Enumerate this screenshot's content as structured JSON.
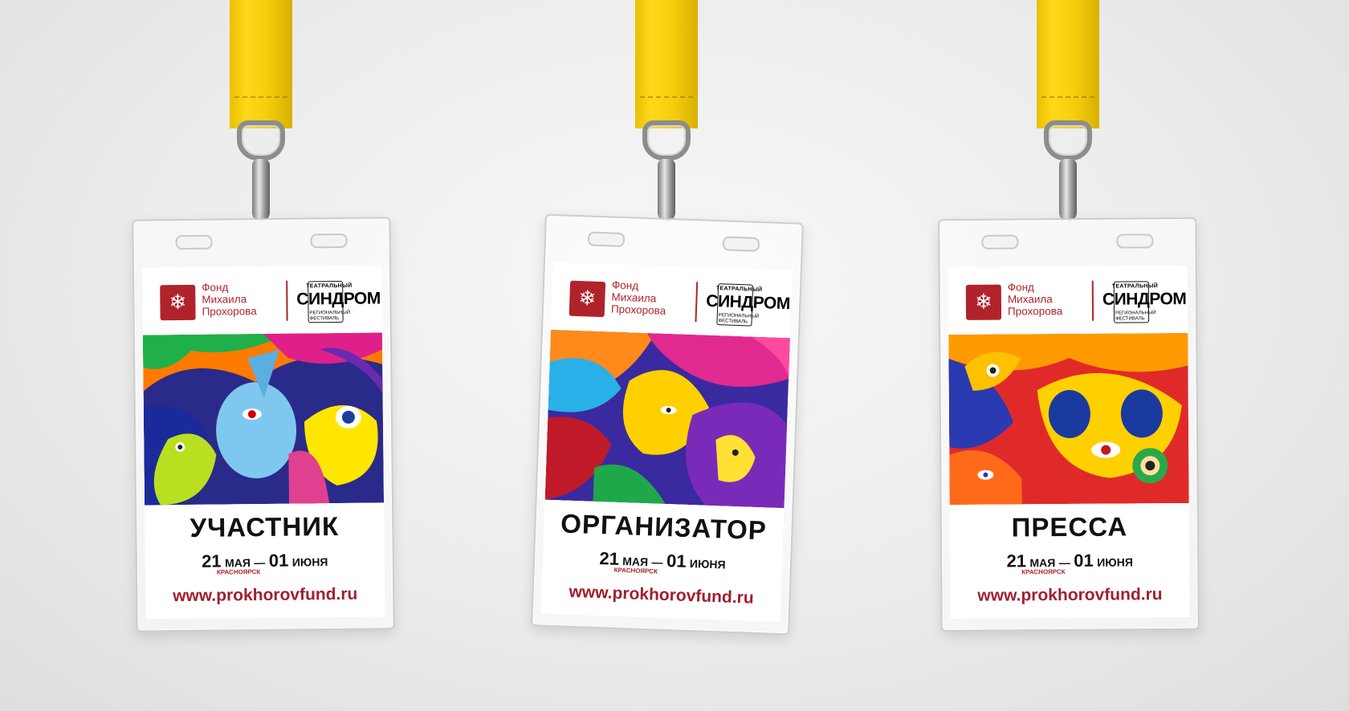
{
  "badges": [
    {
      "fund_name": "Фонд\nМихаила\nПрохорова",
      "fest_top": "ТЕАТРАЛЬНЫЙ",
      "fest_main": "СИНДРОМ",
      "fest_sub": "РЕГИОНАЛЬНЫЙ ФЕСТИВАЛЬ",
      "role": "УЧАСТНИК",
      "date_start_day": "21",
      "date_start_month": "МАЯ",
      "date_dash": "—",
      "date_end_day": "01",
      "date_end_month": "ИЮНЯ",
      "city": "КРАСНОЯРСК",
      "website": "www.prokhorovfund.ru"
    },
    {
      "fund_name": "Фонд\nМихаила\nПрохорова",
      "fest_top": "ТЕАТРАЛЬНЫЙ",
      "fest_main": "СИНДРОМ",
      "fest_sub": "РЕГИОНАЛЬНЫЙ ФЕСТИВАЛЬ",
      "role": "ОРГАНИЗАТОР",
      "date_start_day": "21",
      "date_start_month": "МАЯ",
      "date_dash": "—",
      "date_end_day": "01",
      "date_end_month": "ИЮНЯ",
      "city": "КРАСНОЯРСК",
      "website": "www.prokhorovfund.ru"
    },
    {
      "fund_name": "Фонд\nМихаила\nПрохорова",
      "fest_top": "ТЕАТРАЛЬНЫЙ",
      "fest_main": "СИНДРОМ",
      "fest_sub": "РЕГИОНАЛЬНЫЙ ФЕСТИВАЛЬ",
      "role": "ПРЕССА",
      "date_start_day": "21",
      "date_start_month": "МАЯ",
      "date_dash": "—",
      "date_end_day": "01",
      "date_end_month": "ИЮНЯ",
      "city": "КРАСНОЯРСК",
      "website": "www.prokhorovfund.ru"
    }
  ],
  "colors": {
    "brand_red": "#b0232b",
    "lanyard_yellow": "#f5cf0c"
  }
}
